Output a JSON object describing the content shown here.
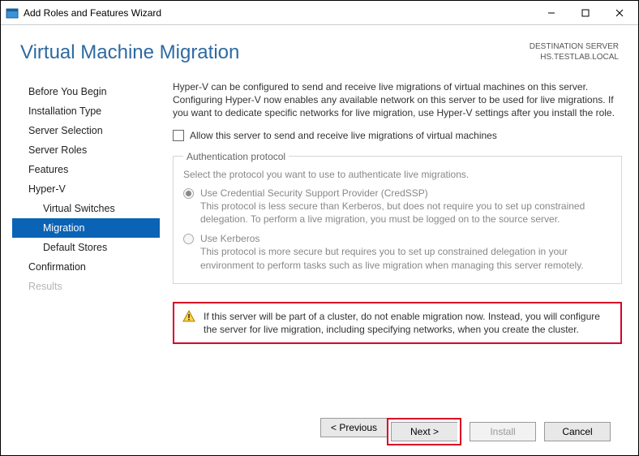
{
  "window": {
    "title": "Add Roles and Features Wizard"
  },
  "header": {
    "page_title": "Virtual Machine Migration",
    "dest_label": "DESTINATION SERVER",
    "dest_value": "HS.TESTLAB.LOCAL"
  },
  "nav": {
    "items": [
      "Before You Begin",
      "Installation Type",
      "Server Selection",
      "Server Roles",
      "Features",
      "Hyper-V",
      "Virtual Switches",
      "Migration",
      "Default Stores",
      "Confirmation",
      "Results"
    ]
  },
  "content": {
    "intro": "Hyper-V can be configured to send and receive live migrations of virtual machines on this server. Configuring Hyper-V now enables any available network on this server to be used for live migrations. If you want to dedicate specific networks for live migration, use Hyper-V settings after you install the role.",
    "checkbox_label": "Allow this server to send and receive live migrations of virtual machines",
    "fieldset_legend": "Authentication protocol",
    "fieldset_desc": "Select the protocol you want to use to authenticate live migrations.",
    "radio1_label": "Use Credential Security Support Provider (CredSSP)",
    "radio1_desc": "This protocol is less secure than Kerberos, but does not require you to set up constrained delegation. To perform a live migration, you must be logged on to the source server.",
    "radio2_label": "Use Kerberos",
    "radio2_desc": "This protocol is more secure but requires you to set up constrained delegation in your environment to perform tasks such as live migration when managing this server remotely.",
    "warning": "If this server will be part of a cluster, do not enable migration now. Instead, you will configure the server for live migration, including specifying networks, when you create the cluster."
  },
  "footer": {
    "previous": "< Previous",
    "next": "Next >",
    "install": "Install",
    "cancel": "Cancel"
  }
}
